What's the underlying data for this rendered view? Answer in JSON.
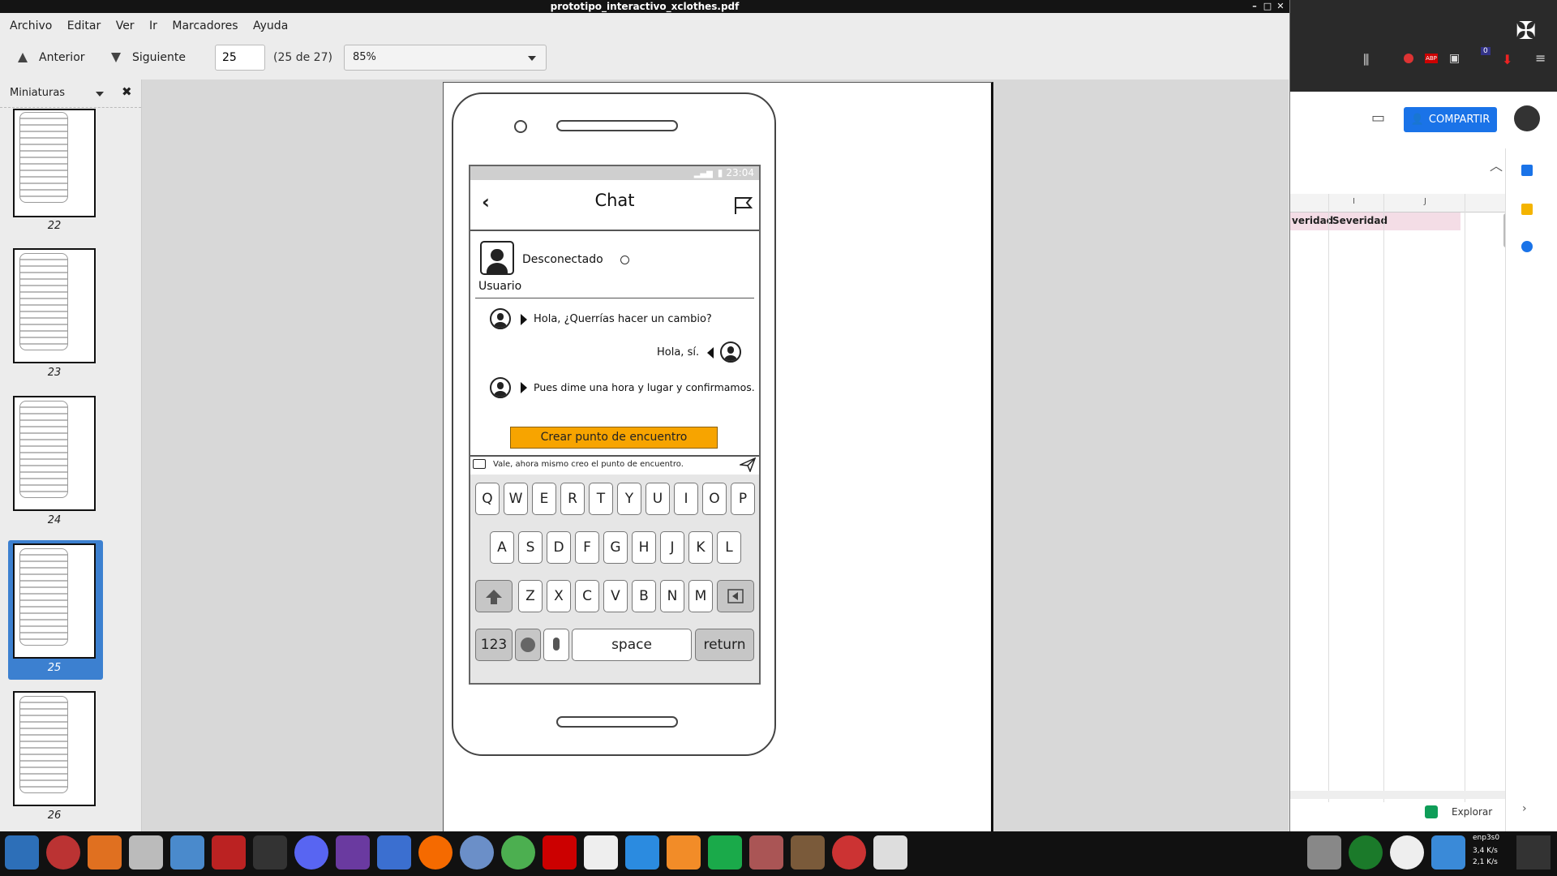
{
  "window": {
    "title": "prototipo_interactivo_xclothes.pdf",
    "controls": [
      "–",
      "□",
      "✕"
    ]
  },
  "menu": [
    "Archivo",
    "Editar",
    "Ver",
    "Ir",
    "Marcadores",
    "Ayuda"
  ],
  "toolbar": {
    "prev_label": "Anterior",
    "next_label": "Siguiente",
    "page_value": "25",
    "page_count": "(25 de 27)",
    "zoom": "85%"
  },
  "sidebar": {
    "title": "Miniaturas",
    "thumbs": [
      "22",
      "23",
      "24",
      "25",
      "26"
    ],
    "selected": "25"
  },
  "mockup": {
    "time": "23:04",
    "title": "Chat",
    "status": "Desconectado",
    "user": "Usuario",
    "messages": [
      "Hola, ¿Querrías hacer un cambio?",
      "Hola, sí.",
      "Pues dime una hora y lugar y confirmamos."
    ],
    "button": "Crear punto de encuentro",
    "input_text": "Vale, ahora mismo creo el punto de encuentro.",
    "keys_row1": [
      "Q",
      "W",
      "E",
      "R",
      "T",
      "Y",
      "U",
      "I",
      "O",
      "P"
    ],
    "keys_row2": [
      "A",
      "S",
      "D",
      "F",
      "G",
      "H",
      "J",
      "K",
      "L"
    ],
    "keys_row3": [
      "Z",
      "X",
      "C",
      "V",
      "B",
      "N",
      "M"
    ],
    "key_123": "123",
    "key_space": "space",
    "key_return": "return"
  },
  "right_window": {
    "share": "COMPARTIR",
    "col_i": "I",
    "col_j": "J",
    "cell_left": "veridad",
    "cell_right": "Severidad",
    "explore": "Explorar",
    "badge": "0"
  },
  "tray": {
    "net": "enp3s0",
    "down": "3,4 K/s",
    "up": "2,1 K/s"
  },
  "colors": {
    "accent_selection": "#3c80d0",
    "orange_button": "#f7a400",
    "share_blue": "#1a73e8"
  }
}
